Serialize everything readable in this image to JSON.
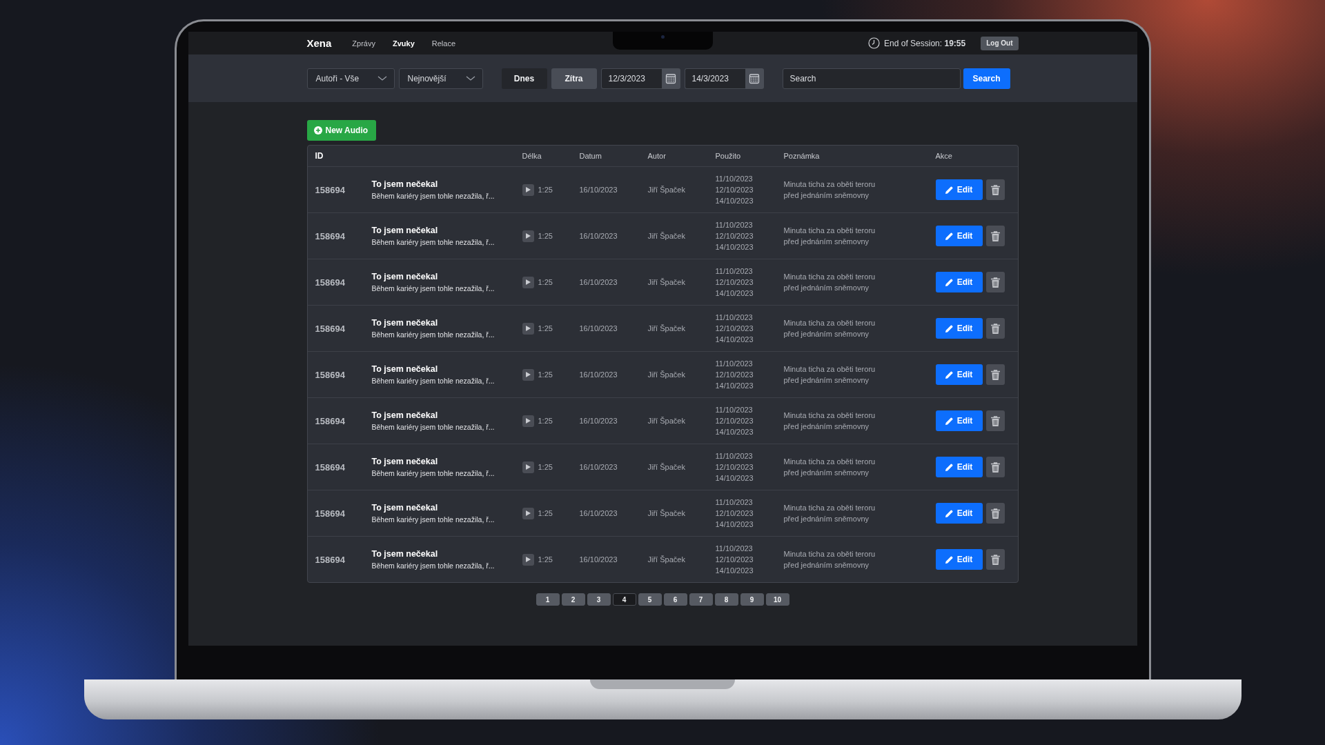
{
  "nav": {
    "brand": "Xena",
    "links": [
      {
        "label": "Zprávy",
        "selected": false
      },
      {
        "label": "Zvuky",
        "selected": true
      },
      {
        "label": "Relace",
        "selected": false
      }
    ],
    "session": "End of Session: **19:55**",
    "logout": "Log Out"
  },
  "filters": {
    "selects": [
      "Autoři - Vše",
      "Nejnovější"
    ],
    "days": [
      {
        "label": "Dnes",
        "selected": false
      },
      {
        "label": "Zítra",
        "selected": true
      }
    ],
    "dates": [
      "12/3/2023",
      "14/3/2023"
    ],
    "search": {
      "placeholder": "Search",
      "button": "Search"
    }
  },
  "new_button": "New Audio",
  "table": {
    "columns": [
      "ID",
      "Délka",
      "Datum",
      "Autor",
      "Použito",
      "Poznámka",
      "Akce"
    ],
    "rows": [
      {
        "id": "158694",
        "title": "To jsem nečekal",
        "subtitle": "Během kariéry jsem tohle nezažila, ř...",
        "length": "1:25",
        "date": "16/10/2023",
        "author": "Jiří Špaček",
        "used": [
          "11/10/2023",
          "12/10/2023",
          "14/10/2023"
        ],
        "note": [
          "Minuta ticha za oběti teroru",
          "před jednáním sněmovny"
        ],
        "edit": "Edit"
      },
      {
        "id": "158694",
        "title": "To jsem nečekal",
        "subtitle": "Během kariéry jsem tohle nezažila, ř...",
        "length": "1:25",
        "date": "16/10/2023",
        "author": "Jiří Špaček",
        "used": [
          "11/10/2023",
          "12/10/2023",
          "14/10/2023"
        ],
        "note": [
          "Minuta ticha za oběti teroru",
          "před jednáním sněmovny"
        ],
        "edit": "Edit"
      },
      {
        "id": "158694",
        "title": "To jsem nečekal",
        "subtitle": "Během kariéry jsem tohle nezažila, ř...",
        "length": "1:25",
        "date": "16/10/2023",
        "author": "Jiří Špaček",
        "used": [
          "11/10/2023",
          "12/10/2023",
          "14/10/2023"
        ],
        "note": [
          "Minuta ticha za oběti teroru",
          "před jednáním sněmovny"
        ],
        "edit": "Edit"
      },
      {
        "id": "158694",
        "title": "To jsem nečekal",
        "subtitle": "Během kariéry jsem tohle nezažila, ř...",
        "length": "1:25",
        "date": "16/10/2023",
        "author": "Jiří Špaček",
        "used": [
          "11/10/2023",
          "12/10/2023",
          "14/10/2023"
        ],
        "note": [
          "Minuta ticha za oběti teroru",
          "před jednáním sněmovny"
        ],
        "edit": "Edit"
      },
      {
        "id": "158694",
        "title": "To jsem nečekal",
        "subtitle": "Během kariéry jsem tohle nezažila, ř...",
        "length": "1:25",
        "date": "16/10/2023",
        "author": "Jiří Špaček",
        "used": [
          "11/10/2023",
          "12/10/2023",
          "14/10/2023"
        ],
        "note": [
          "Minuta ticha za oběti teroru",
          "před jednáním sněmovny"
        ],
        "edit": "Edit"
      },
      {
        "id": "158694",
        "title": "To jsem nečekal",
        "subtitle": "Během kariéry jsem tohle nezažila, ř...",
        "length": "1:25",
        "date": "16/10/2023",
        "author": "Jiří Špaček",
        "used": [
          "11/10/2023",
          "12/10/2023",
          "14/10/2023"
        ],
        "note": [
          "Minuta ticha za oběti teroru",
          "před jednáním sněmovny"
        ],
        "edit": "Edit"
      },
      {
        "id": "158694",
        "title": "To jsem nečekal",
        "subtitle": "Během kariéry jsem tohle nezažila, ř...",
        "length": "1:25",
        "date": "16/10/2023",
        "author": "Jiří Špaček",
        "used": [
          "11/10/2023",
          "12/10/2023",
          "14/10/2023"
        ],
        "note": [
          "Minuta ticha za oběti teroru",
          "před jednáním sněmovny"
        ],
        "edit": "Edit"
      },
      {
        "id": "158694",
        "title": "To jsem nečekal",
        "subtitle": "Během kariéry jsem tohle nezažila, ř...",
        "length": "1:25",
        "date": "16/10/2023",
        "author": "Jiří Špaček",
        "used": [
          "11/10/2023",
          "12/10/2023",
          "14/10/2023"
        ],
        "note": [
          "Minuta ticha za oběti teroru",
          "před jednáním sněmovny"
        ],
        "edit": "Edit"
      },
      {
        "id": "158694",
        "title": "To jsem nečekal",
        "subtitle": "Během kariéry jsem tohle nezažila, ř...",
        "length": "1:25",
        "date": "16/10/2023",
        "author": "Jiří Špaček",
        "used": [
          "11/10/2023",
          "12/10/2023",
          "14/10/2023"
        ],
        "note": [
          "Minuta ticha za oběti teroru",
          "před jednáním sněmovny"
        ],
        "edit": "Edit"
      }
    ]
  },
  "pagination": [
    {
      "label": "1",
      "selected": false
    },
    {
      "label": "2",
      "selected": false
    },
    {
      "label": "3",
      "selected": false
    },
    {
      "label": "4",
      "selected": true
    },
    {
      "label": "5",
      "selected": false
    },
    {
      "label": "6",
      "selected": false
    },
    {
      "label": "7",
      "selected": false
    },
    {
      "label": "8",
      "selected": false
    },
    {
      "label": "9",
      "selected": false
    },
    {
      "label": "10",
      "selected": false
    }
  ]
}
